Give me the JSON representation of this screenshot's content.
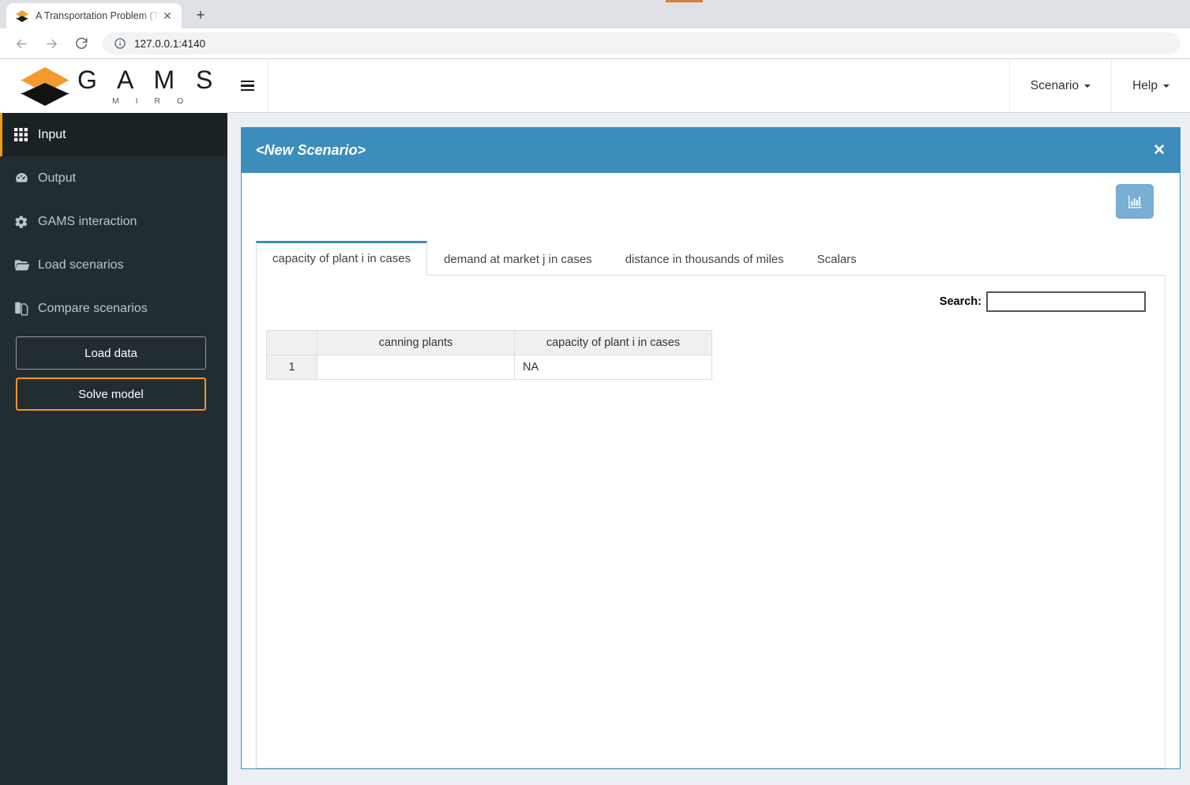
{
  "browser": {
    "tab_title": "A Transportation Problem (TRNSP",
    "tab_close_glyph": "✕",
    "new_tab_glyph": "+",
    "url": "127.0.0.1:4140",
    "back_icon": "back-arrow-icon",
    "forward_icon": "forward-arrow-icon",
    "reload_icon": "reload-icon",
    "info_icon": "site-info-icon"
  },
  "sidebar": {
    "logo": {
      "brand": "G A M S",
      "sub": "M I R O"
    },
    "items": [
      {
        "label": "Input",
        "icon": "grid-icon",
        "active": true
      },
      {
        "label": "Output",
        "icon": "gauge-icon",
        "active": false
      },
      {
        "label": "GAMS interaction",
        "icon": "gear-icon",
        "active": false
      },
      {
        "label": "Load scenarios",
        "icon": "folder-open-icon",
        "active": false
      },
      {
        "label": "Compare scenarios",
        "icon": "copy-files-icon",
        "active": false
      }
    ],
    "buttons": {
      "load_data": "Load data",
      "solve_model": "Solve model"
    },
    "colors": {
      "bg": "#222d32",
      "active_bg": "#1a2226",
      "accent": "#f0951b",
      "text": "#b8c7ce"
    }
  },
  "topnav": {
    "menu_toggle_icon": "hamburger-icon",
    "scenario_label": "Scenario",
    "help_label": "Help"
  },
  "scenario_panel": {
    "title": "<New Scenario>",
    "close_glyph": "✕",
    "chart_button_icon": "bar-chart-icon",
    "accent_color": "#3c8dbc",
    "tabs": [
      {
        "label": "capacity of plant i in cases",
        "active": true
      },
      {
        "label": "demand at market j in cases",
        "active": false
      },
      {
        "label": "distance in thousands of miles",
        "active": false
      },
      {
        "label": "Scalars",
        "active": false
      }
    ],
    "search": {
      "label": "Search:",
      "value": "",
      "placeholder": ""
    },
    "table": {
      "columns": [
        "",
        "canning plants",
        "capacity of plant i in cases"
      ],
      "rows": [
        {
          "index": "1",
          "canning_plant": "",
          "capacity": "NA"
        }
      ]
    }
  }
}
